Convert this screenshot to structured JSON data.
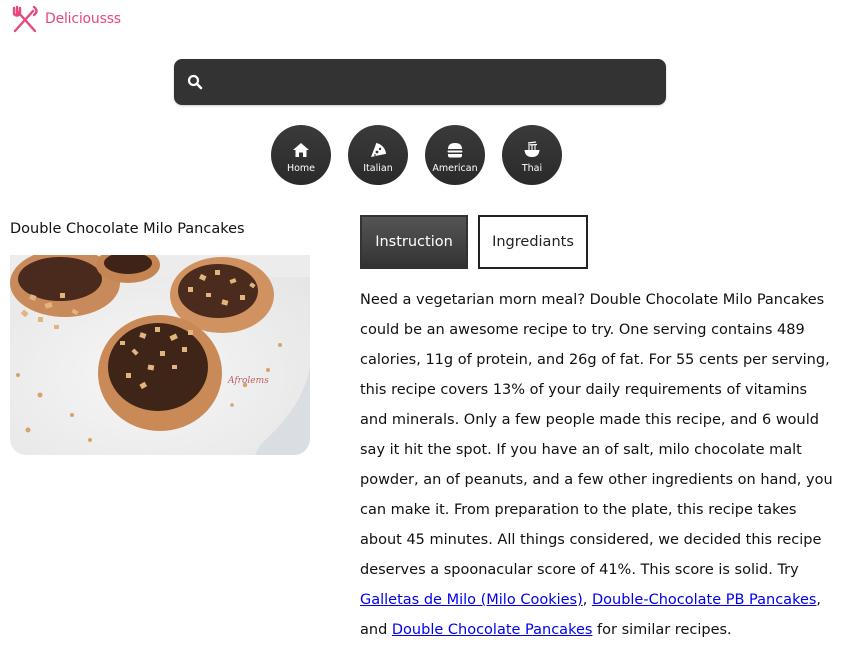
{
  "brand": {
    "name": "Deliciousss",
    "icon": "fork-knife-icon",
    "color": "#e8487b"
  },
  "search": {
    "icon": "search-icon",
    "value": "",
    "placeholder": ""
  },
  "categories": [
    {
      "label": "Home",
      "icon": "home-icon"
    },
    {
      "label": "Italian",
      "icon": "pizza-icon"
    },
    {
      "label": "American",
      "icon": "burger-icon"
    },
    {
      "label": "Thai",
      "icon": "noodle-bowl-icon"
    }
  ],
  "recipe": {
    "title": "Double Chocolate Milo Pancakes",
    "image_watermark": "Afrolems"
  },
  "tabs": {
    "instruction": "Instruction",
    "ingredients": "Ingrediants",
    "active": "instruction"
  },
  "summary": {
    "text_1": "Need a vegetarian morn meal? Double Chocolate Milo Pancakes could be an awesome recipe to try. One serving contains 489 calories, 11g of protein, and 26g of fat. For 55 cents per serving, this recipe covers 13% of your daily requirements of vitamins and minerals. Only a few people made this recipe, and 6 would say it hit the spot. If you have an of salt, milo chocolate malt powder, an of peanuts, and a few other ingredients on hand, you can make it. From preparation to the plate, this recipe takes about 45 minutes. All things considered, we decided this recipe deserves a spoonacular score of 41%. This score is solid. Try ",
    "link_1": "Galletas de Milo (Milo Cookies)",
    "sep_1": ", ",
    "link_2": "Double-Chocolate PB Pancakes",
    "sep_2": ", and ",
    "link_3": "Double Chocolate Pancakes",
    "text_end": " for similar recipes."
  }
}
